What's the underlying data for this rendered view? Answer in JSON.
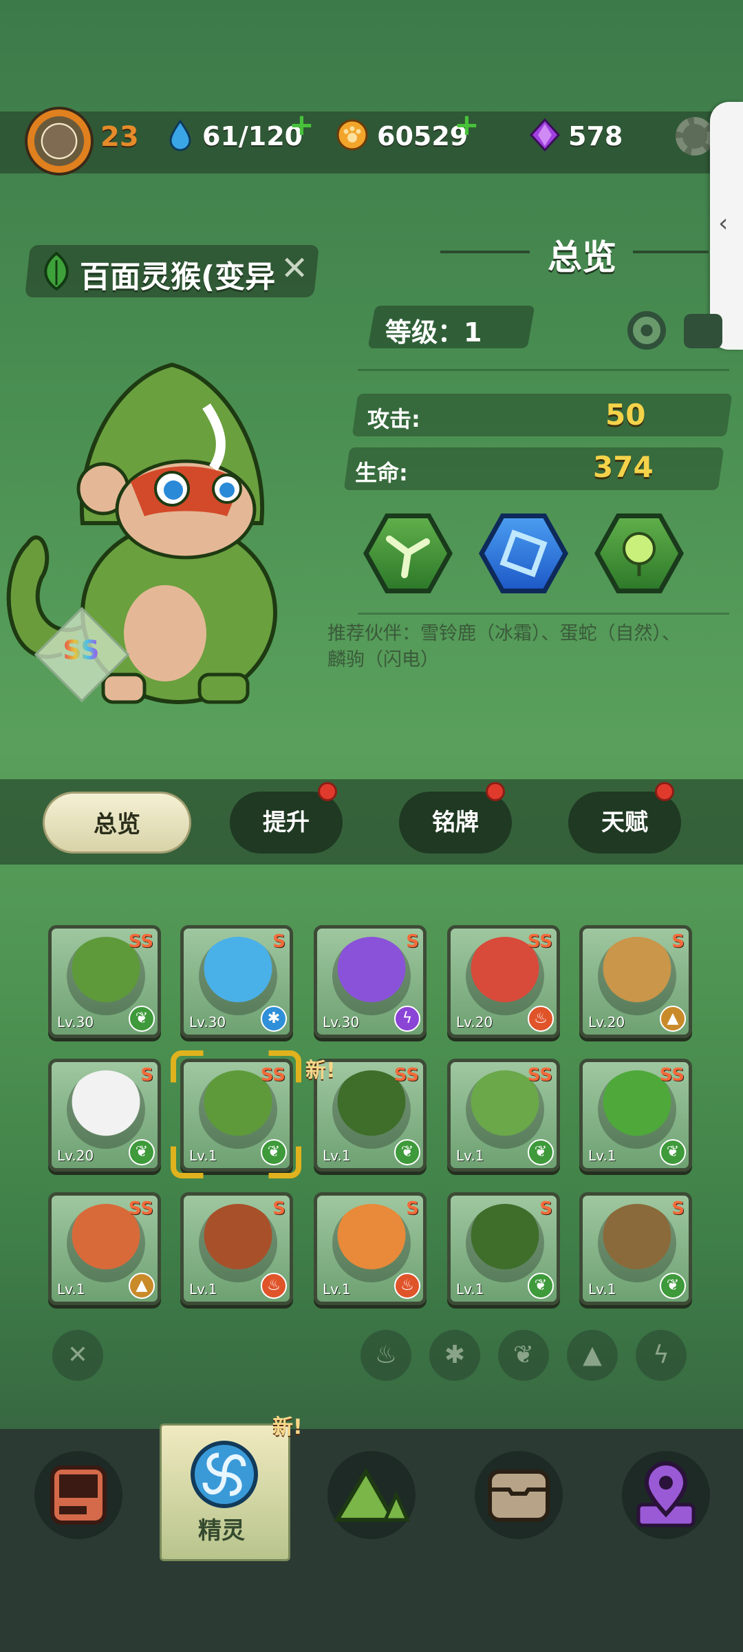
{
  "player": {
    "level": "23"
  },
  "resources": {
    "water": "61/120",
    "coins": "60529",
    "gems": "578"
  },
  "monster": {
    "name": "百面灵猴(变异",
    "close_glyph": "✕",
    "grade": "SS",
    "level_text": "等级：1",
    "attack_label": "攻击:",
    "attack_value": "50",
    "hp_label": "生命:",
    "hp_value": "374",
    "partners": "推荐伙伴：雪铃鹿（冰霜）、蛋蛇（自然）、麟驹（闪电）"
  },
  "section_title": "总览",
  "tabs": [
    {
      "label": "总览"
    },
    {
      "label": "提升"
    },
    {
      "label": "铭牌"
    },
    {
      "label": "天赋"
    }
  ],
  "roster": [
    {
      "lv": "Lv.30",
      "rank": "SS",
      "element": "leaf-icon",
      "color": "#3e9a3a"
    },
    {
      "lv": "Lv.30",
      "rank": "S",
      "element": "snowflake-icon",
      "color": "#2f8fd8"
    },
    {
      "lv": "Lv.30",
      "rank": "S",
      "element": "lightning-icon",
      "color": "#8a44d6"
    },
    {
      "lv": "Lv.20",
      "rank": "SS",
      "element": "fire-icon",
      "color": "#e0542a"
    },
    {
      "lv": "Lv.20",
      "rank": "S",
      "element": "earth-icon",
      "color": "#c98a2a"
    },
    {
      "lv": "Lv.20",
      "rank": "S",
      "element": "leaf-icon",
      "color": "#3e9a3a"
    },
    {
      "lv": "Lv.1",
      "rank": "SS",
      "element": "leaf-icon",
      "color": "#3e9a3a"
    },
    {
      "lv": "Lv.1",
      "rank": "SS",
      "element": "leaf-icon",
      "color": "#3e9a3a"
    },
    {
      "lv": "Lv.1",
      "rank": "SS",
      "element": "leaf-icon",
      "color": "#3e9a3a"
    },
    {
      "lv": "Lv.1",
      "rank": "SS",
      "element": "leaf-icon",
      "color": "#3e9a3a"
    },
    {
      "lv": "Lv.1",
      "rank": "SS",
      "element": "earth-icon",
      "color": "#c98a2a"
    },
    {
      "lv": "Lv.1",
      "rank": "S",
      "element": "fire-icon",
      "color": "#e0542a"
    },
    {
      "lv": "Lv.1",
      "rank": "S",
      "element": "fire-icon",
      "color": "#e0542a"
    },
    {
      "lv": "Lv.1",
      "rank": "S",
      "element": "leaf-icon",
      "color": "#3e9a3a"
    },
    {
      "lv": "Lv.1",
      "rank": "S",
      "element": "leaf-icon",
      "color": "#3e9a3a"
    }
  ],
  "new_label": "新!",
  "bottom_nav": {
    "active_label": "精灵"
  }
}
